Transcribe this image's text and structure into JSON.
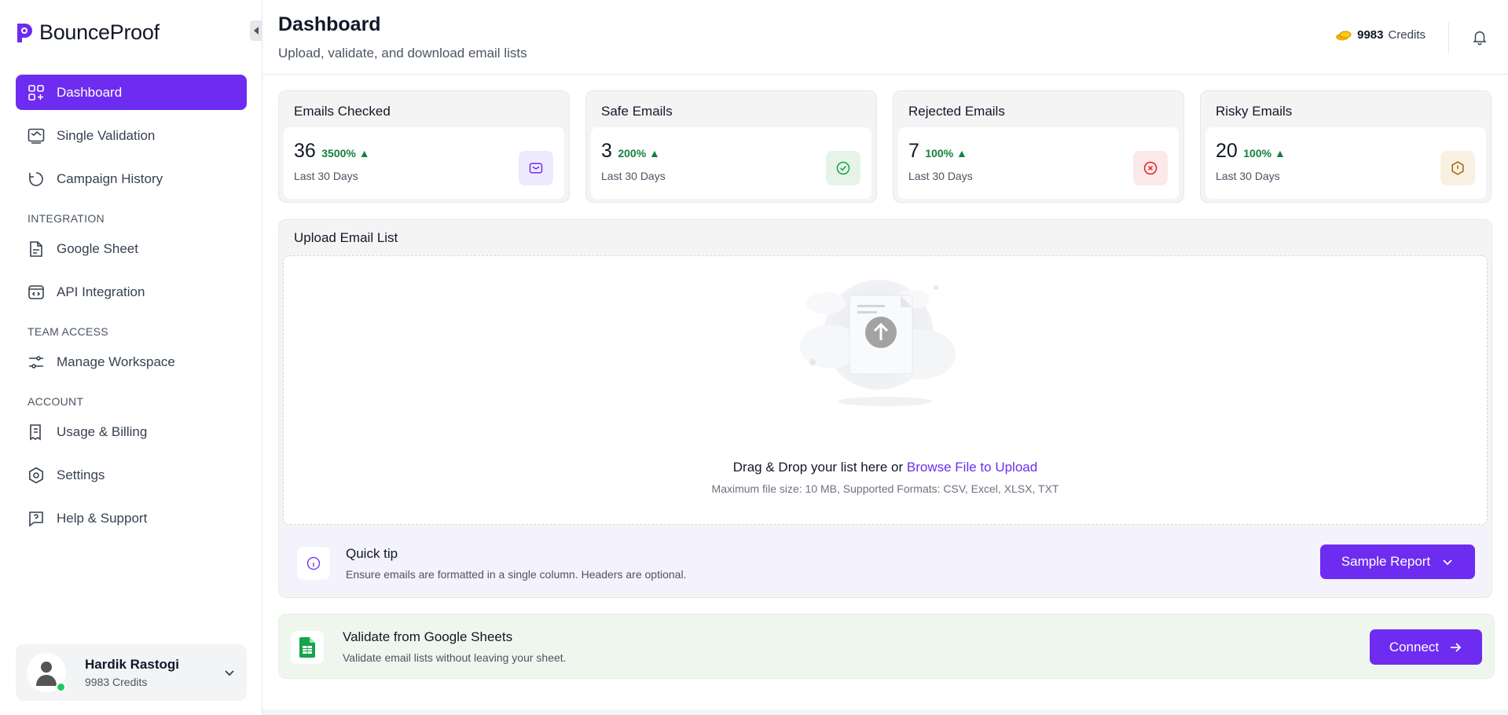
{
  "brand": {
    "name": "BounceProof",
    "accent": "#6d2cf0"
  },
  "sidebar": {
    "items": [
      {
        "label": "Dashboard",
        "icon": "dashboard-icon",
        "active": true
      },
      {
        "label": "Single Validation",
        "icon": "single-validation-icon"
      },
      {
        "label": "Campaign History",
        "icon": "history-icon"
      }
    ],
    "sections": [
      {
        "label": "INTEGRATION",
        "items": [
          {
            "label": "Google Sheet",
            "icon": "sheet-icon"
          },
          {
            "label": "API Integration",
            "icon": "api-icon"
          }
        ]
      },
      {
        "label": "TEAM ACCESS",
        "items": [
          {
            "label": "Manage Workspace",
            "icon": "sliders-icon"
          }
        ]
      },
      {
        "label": "ACCOUNT",
        "items": [
          {
            "label": "Usage & Billing",
            "icon": "receipt-icon"
          },
          {
            "label": "Settings",
            "icon": "gear-icon"
          },
          {
            "label": "Help & Support",
            "icon": "help-icon"
          }
        ]
      }
    ],
    "user": {
      "name": "Hardik Rastogi",
      "credits": "9983 Credits"
    }
  },
  "header": {
    "title": "Dashboard",
    "subtitle": "Upload, validate, and download email lists",
    "credits_value": "9983",
    "credits_label": "Credits"
  },
  "stats": [
    {
      "title": "Emails Checked",
      "value": "36",
      "change": "3500%",
      "period": "Last 30 Days",
      "icon": "mail-icon",
      "icon_bg": "#efe9fd",
      "icon_color": "#6d2cf0"
    },
    {
      "title": "Safe Emails",
      "value": "3",
      "change": "200%",
      "period": "Last 30 Days",
      "icon": "check-circle-icon",
      "icon_bg": "#e6f4e8",
      "icon_color": "#16a34a"
    },
    {
      "title": "Rejected Emails",
      "value": "7",
      "change": "100%",
      "period": "Last 30 Days",
      "icon": "x-circle-icon",
      "icon_bg": "#fce8e8",
      "icon_color": "#dc2626"
    },
    {
      "title": "Risky Emails",
      "value": "20",
      "change": "100%",
      "period": "Last 30 Days",
      "icon": "warning-icon",
      "icon_bg": "#f8f1e2",
      "icon_color": "#a16207"
    }
  ],
  "upload": {
    "title": "Upload Email List",
    "drop_text": "Drag & Drop your list here or",
    "browse_link": "Browse File to Upload",
    "drop_sub": "Maximum file size: 10 MB, Supported Formats: CSV, Excel, XLSX, TXT",
    "tip_title": "Quick tip",
    "tip_desc": "Ensure emails are formatted in a single column. Headers are optional.",
    "sample_button": "Sample Report"
  },
  "sheets": {
    "title": "Validate from Google Sheets",
    "desc": "Validate email lists without leaving your sheet.",
    "connect_button": "Connect"
  }
}
